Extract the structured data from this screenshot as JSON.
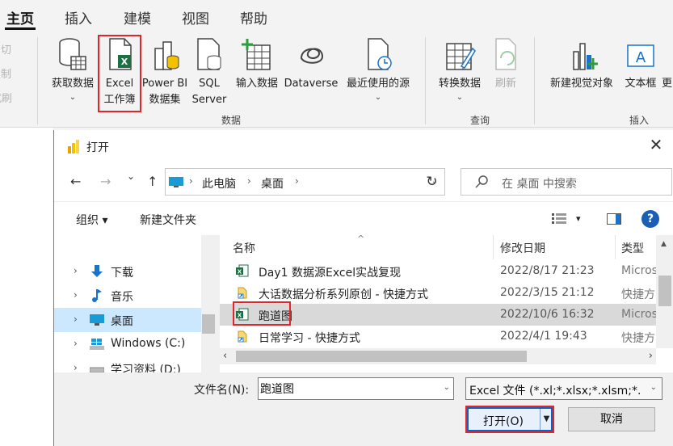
{
  "ribbon": {
    "tabs": [
      {
        "label": "主页",
        "active": true
      },
      {
        "label": "插入",
        "active": false
      },
      {
        "label": "建模",
        "active": false
      },
      {
        "label": "视图",
        "active": false
      },
      {
        "label": "帮助",
        "active": false
      }
    ],
    "clipboard": [
      "剪切",
      "复制",
      "格式刷"
    ],
    "buttons": {
      "get_data": {
        "line1": "获取数据",
        "line2": ""
      },
      "excel": {
        "line1": "Excel",
        "line2": "工作簿"
      },
      "powerbi": {
        "line1": "Power BI",
        "line2": "数据集"
      },
      "sql": {
        "line1": "SQL",
        "line2": "Server"
      },
      "enter_data": {
        "line1": "输入数据"
      },
      "dataverse": {
        "line1": "Dataverse"
      },
      "recent": {
        "line1": "最近使用的源"
      },
      "transform": {
        "line1": "转换数据"
      },
      "refresh": {
        "line1": "刷新"
      },
      "new_visual": {
        "line1": "新建视觉对象"
      },
      "textbox": {
        "line1": "文本框"
      },
      "more": {
        "line1": "更"
      }
    },
    "groups": {
      "data": "数据",
      "query": "查询",
      "insert": "插入"
    }
  },
  "dialog": {
    "title": "打开",
    "close_glyph": "✕",
    "nav": {
      "back": "←",
      "forward": "→",
      "recent": "⌄",
      "up": "↑"
    },
    "address": {
      "segments": [
        "此电脑",
        "桌面"
      ],
      "sep": "›"
    },
    "refresh_glyph": "↻",
    "search_placeholder": "在 桌面 中搜索",
    "commands": {
      "organize": "组织 ▾",
      "new_folder": "新建文件夹",
      "view_dd": "▾",
      "help": "?"
    },
    "tree": [
      {
        "label": "下载",
        "icon": "download-icon",
        "selected": false
      },
      {
        "label": "音乐",
        "icon": "music-icon",
        "selected": false
      },
      {
        "label": "桌面",
        "icon": "desktop-icon",
        "selected": true
      },
      {
        "label": "Windows (C:)",
        "icon": "windows-drive-icon",
        "selected": false
      },
      {
        "label": "学习资料 (D:)",
        "icon": "drive-icon",
        "selected": false
      }
    ],
    "columns": {
      "name": "名称",
      "date": "修改日期",
      "type": "类型"
    },
    "files": [
      {
        "name": "Day1 数据源Excel实战复现",
        "date": "2022/8/17 21:23",
        "type": "Micros",
        "icon": "excel-file-icon",
        "highlight": false
      },
      {
        "name": "大话数据分析系列原创 - 快捷方式",
        "date": "2022/3/15 21:12",
        "type": "快捷方",
        "icon": "shortcut-icon",
        "highlight": false
      },
      {
        "name": "跑道图",
        "date": "2022/10/6 16:32",
        "type": "Micros",
        "icon": "excel-file-icon",
        "highlight": true
      },
      {
        "name": "日常学习 - 快捷方式",
        "date": "2022/4/1 19:43",
        "type": "快捷方",
        "icon": "shortcut-icon",
        "highlight": false
      }
    ],
    "filename_label": "文件名(N):",
    "filename_value": "跑道图",
    "filter_value": "Excel 文件 (*.xl;*.xlsx;*.xlsm;*.",
    "open_label": "打开(O)",
    "cancel_label": "取消"
  },
  "colors": {
    "accent_red": "#e0262a",
    "excel_green": "#1d7044",
    "selection_blue": "#cce8ff",
    "help_blue": "#1a5fb4"
  }
}
